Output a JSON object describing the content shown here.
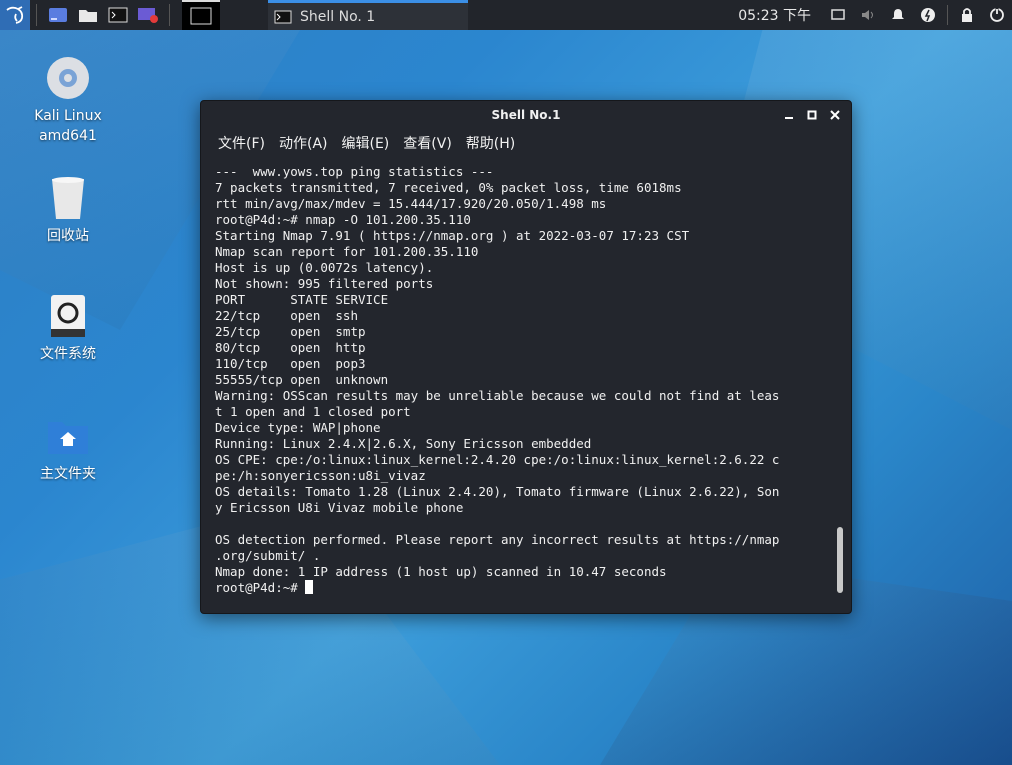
{
  "panel": {
    "clock": "05:23 下午",
    "active_task_label": "Shell No. 1"
  },
  "desktop": {
    "icons": [
      {
        "label_line1": "Kali Linux",
        "label_line2": "amd641"
      },
      {
        "label_line1": "回收站"
      },
      {
        "label_line1": "文件系统"
      },
      {
        "label_line1": "主文件夹"
      }
    ]
  },
  "window": {
    "title": "Shell No.1",
    "menu": [
      "文件(F)",
      "动作(A)",
      "编辑(E)",
      "查看(V)",
      "帮助(H)"
    ],
    "terminal_lines": [
      "---  www.yows.top ping statistics ---",
      "7 packets transmitted, 7 received, 0% packet loss, time 6018ms",
      "rtt min/avg/max/mdev = 15.444/17.920/20.050/1.498 ms",
      "root@P4d:~# nmap -O 101.200.35.110",
      "Starting Nmap 7.91 ( https://nmap.org ) at 2022-03-07 17:23 CST",
      "Nmap scan report for 101.200.35.110",
      "Host is up (0.0072s latency).",
      "Not shown: 995 filtered ports",
      "PORT      STATE SERVICE",
      "22/tcp    open  ssh",
      "25/tcp    open  smtp",
      "80/tcp    open  http",
      "110/tcp   open  pop3",
      "55555/tcp open  unknown",
      "Warning: OSScan results may be unreliable because we could not find at leas",
      "t 1 open and 1 closed port",
      "Device type: WAP|phone",
      "Running: Linux 2.4.X|2.6.X, Sony Ericsson embedded",
      "OS CPE: cpe:/o:linux:linux_kernel:2.4.20 cpe:/o:linux:linux_kernel:2.6.22 c",
      "pe:/h:sonyericsson:u8i_vivaz",
      "OS details: Tomato 1.28 (Linux 2.4.20), Tomato firmware (Linux 2.6.22), Son",
      "y Ericsson U8i Vivaz mobile phone",
      "",
      "OS detection performed. Please report any incorrect results at https://nmap",
      ".org/submit/ .",
      "Nmap done: 1 IP address (1 host up) scanned in 10.47 seconds"
    ],
    "prompt": "root@P4d:~# "
  },
  "colors": {
    "panel_bg": "#22252b",
    "accent": "#3b8fe6",
    "terminal_bg": "#23262d",
    "terminal_fg": "#f0f0f0"
  },
  "icons": {
    "launcher": "kali-dragon-icon",
    "tray": [
      "screen-icon",
      "volume-icon",
      "notification-bell-icon",
      "power-manager-icon",
      "lock-icon",
      "logout-icon"
    ]
  }
}
